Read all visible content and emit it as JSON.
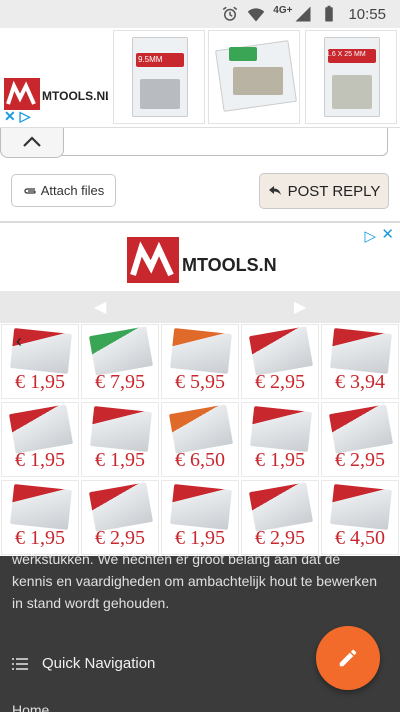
{
  "status_bar": {
    "time": "10:55",
    "network": "4G+",
    "icons": [
      "alarm-icon",
      "wifi-icon",
      "signal-icon",
      "battery-icon"
    ]
  },
  "top_ad": {
    "brand": "MTOOLS.NL",
    "tiles": [
      {
        "label": "9.5MM",
        "accent": "#c8272d"
      },
      {
        "label": "",
        "accent": "#3aa655"
      },
      {
        "label": "1.6 X 25 MM",
        "accent": "#c8272d"
      }
    ]
  },
  "reply": {
    "attach_label": "Attach files",
    "post_label": "POST REPLY"
  },
  "big_ad": {
    "brand": "MTOOLS.NL",
    "prices": [
      [
        "€ 1,95",
        "€ 7,95",
        "€ 5,95",
        "€ 2,95",
        "€ 3,94"
      ],
      [
        "€ 1,95",
        "€ 1,95",
        "€ 6,50",
        "€ 1,95",
        "€ 2,95"
      ],
      [
        "€ 1,95",
        "€ 2,95",
        "€ 1,95",
        "€ 2,95",
        "€ 4,50"
      ]
    ],
    "product_accents": [
      [
        "#c8272d",
        "#3aa655",
        "#e06a2a",
        "#c8272d",
        "#c8272d"
      ],
      [
        "#c8272d",
        "#c8272d",
        "#e06a2a",
        "#c8272d",
        "#c8272d"
      ],
      [
        "#c8272d",
        "#c8272d",
        "#c8272d",
        "#c8272d",
        "#c8272d"
      ]
    ]
  },
  "footer": {
    "paragraph_lines": [
      "werkstukken. We hechten er groot belang aan dat de",
      "kennis en vaardigheden om ambachtelijk hout te bewerken",
      "in stand wordt gehouden."
    ],
    "quick_nav_label": "Quick Navigation",
    "home_label": "Home"
  },
  "colors": {
    "accent": "#f26b2a",
    "brand_red": "#c8272d",
    "dark_bg": "#3b3b3b"
  }
}
